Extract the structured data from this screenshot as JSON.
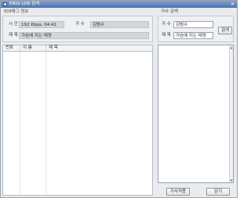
{
  "window": {
    "title": "ENGI LDB 검색",
    "close_glyph": "✕"
  },
  "info": {
    "group_label": "ID3태그 정보",
    "time_label": "시 간",
    "time_value": "192 Kbps, 04:41",
    "artist_label": "가 수",
    "artist_value": "김범수",
    "song_label": "제 목",
    "song_value": "가슴에 지는 태양"
  },
  "search": {
    "group_label": "가사 검색",
    "artist_label": "가 수",
    "artist_value": "김범수",
    "song_label": "제 목",
    "song_value": "가슴에 지는 태양",
    "button_label": "검색"
  },
  "results": {
    "columns": [
      "번호",
      "이 름",
      "제 목"
    ]
  },
  "footer": {
    "lyrics_button": "가사적용",
    "close_button": "닫기"
  }
}
